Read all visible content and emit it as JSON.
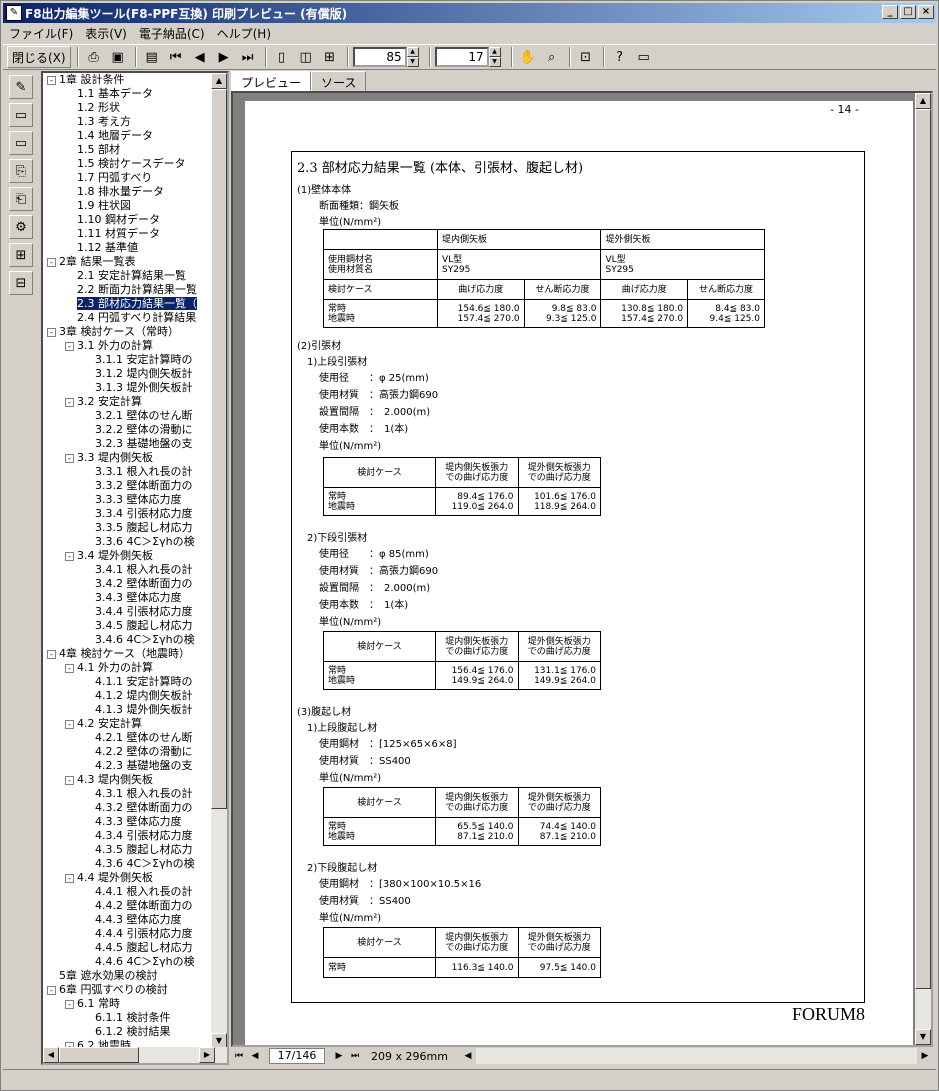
{
  "window": {
    "title": "F8出力編集ツール(F8-PPF互換) 印刷プレビュー (有償版)",
    "icon": "app-document-icon",
    "controls": [
      "_",
      "□",
      "×"
    ]
  },
  "menu": [
    "ファイル(F)",
    "表示(V)",
    "電子納品(C)",
    "ヘルプ(H)"
  ],
  "toolbar": {
    "close_label": "閉じる(X)",
    "zoom_value": "85",
    "page_value": "17"
  },
  "tree": {
    "items": [
      {
        "d": 0,
        "e": "-",
        "t": "1章 設計条件"
      },
      {
        "d": 1,
        "t": "1.1 基本データ"
      },
      {
        "d": 1,
        "t": "1.2 形状"
      },
      {
        "d": 1,
        "t": "1.3 考え方"
      },
      {
        "d": 1,
        "t": "1.4 地層データ"
      },
      {
        "d": 1,
        "t": "1.5 部材"
      },
      {
        "d": 1,
        "t": "1.5 検討ケースデータ"
      },
      {
        "d": 1,
        "t": "1.7 円弧すべり"
      },
      {
        "d": 1,
        "t": "1.8 排水量データ"
      },
      {
        "d": 1,
        "t": "1.9 柱状図"
      },
      {
        "d": 1,
        "t": "1.10 鋼材データ"
      },
      {
        "d": 1,
        "t": "1.11 材質データ"
      },
      {
        "d": 1,
        "t": "1.12 基準値"
      },
      {
        "d": 0,
        "e": "-",
        "t": "2章 結果一覧表"
      },
      {
        "d": 1,
        "t": "2.1 安定計算結果一覧"
      },
      {
        "d": 1,
        "t": "2.2 断面力計算結果一覧"
      },
      {
        "d": 1,
        "t": "2.3 部材応力結果一覧（",
        "s": true
      },
      {
        "d": 1,
        "t": "2.4 円弧すべり計算結果"
      },
      {
        "d": 0,
        "e": "-",
        "t": "3章 検討ケース（常時）"
      },
      {
        "d": 1,
        "e": "-",
        "t": "3.1 外力の計算"
      },
      {
        "d": 2,
        "t": "3.1.1 安定計算時の"
      },
      {
        "d": 2,
        "t": "3.1.2 堤内側矢板計"
      },
      {
        "d": 2,
        "t": "3.1.3 堤外側矢板計"
      },
      {
        "d": 1,
        "e": "-",
        "t": "3.2 安定計算"
      },
      {
        "d": 2,
        "t": "3.2.1 壁体のせん断"
      },
      {
        "d": 2,
        "t": "3.2.2 壁体の滑動に"
      },
      {
        "d": 2,
        "t": "3.2.3 基礎地盤の支"
      },
      {
        "d": 1,
        "e": "-",
        "t": "3.3 堤内側矢板"
      },
      {
        "d": 2,
        "t": "3.3.1 根入れ長の計"
      },
      {
        "d": 2,
        "t": "3.3.2 壁体断面力の"
      },
      {
        "d": 2,
        "t": "3.3.3 壁体応力度"
      },
      {
        "d": 2,
        "t": "3.3.4 引張材応力度"
      },
      {
        "d": 2,
        "t": "3.3.5 腹起し材応力"
      },
      {
        "d": 2,
        "t": "3.3.6 4C＞Σγhの検"
      },
      {
        "d": 1,
        "e": "-",
        "t": "3.4 堤外側矢板"
      },
      {
        "d": 2,
        "t": "3.4.1 根入れ長の計"
      },
      {
        "d": 2,
        "t": "3.4.2 壁体断面力の"
      },
      {
        "d": 2,
        "t": "3.4.3 壁体応力度"
      },
      {
        "d": 2,
        "t": "3.4.4 引張材応力度"
      },
      {
        "d": 2,
        "t": "3.4.5 腹起し材応力"
      },
      {
        "d": 2,
        "t": "3.4.6 4C＞Σγhの検"
      },
      {
        "d": 0,
        "e": "-",
        "t": "4章 検討ケース（地震時）"
      },
      {
        "d": 1,
        "e": "-",
        "t": "4.1 外力の計算"
      },
      {
        "d": 2,
        "t": "4.1.1 安定計算時の"
      },
      {
        "d": 2,
        "t": "4.1.2 堤内側矢板計"
      },
      {
        "d": 2,
        "t": "4.1.3 堤外側矢板計"
      },
      {
        "d": 1,
        "e": "-",
        "t": "4.2 安定計算"
      },
      {
        "d": 2,
        "t": "4.2.1 壁体のせん断"
      },
      {
        "d": 2,
        "t": "4.2.2 壁体の滑動に"
      },
      {
        "d": 2,
        "t": "4.2.3 基礎地盤の支"
      },
      {
        "d": 1,
        "e": "-",
        "t": "4.3 堤内側矢板"
      },
      {
        "d": 2,
        "t": "4.3.1 根入れ長の計"
      },
      {
        "d": 2,
        "t": "4.3.2 壁体断面力の"
      },
      {
        "d": 2,
        "t": "4.3.3 壁体応力度"
      },
      {
        "d": 2,
        "t": "4.3.4 引張材応力度"
      },
      {
        "d": 2,
        "t": "4.3.5 腹起し材応力"
      },
      {
        "d": 2,
        "t": "4.3.6 4C＞Σγhの検"
      },
      {
        "d": 1,
        "e": "-",
        "t": "4.4 堤外側矢板"
      },
      {
        "d": 2,
        "t": "4.4.1 根入れ長の計"
      },
      {
        "d": 2,
        "t": "4.4.2 壁体断面力の"
      },
      {
        "d": 2,
        "t": "4.4.3 壁体応力度"
      },
      {
        "d": 2,
        "t": "4.4.4 引張材応力度"
      },
      {
        "d": 2,
        "t": "4.4.5 腹起し材応力"
      },
      {
        "d": 2,
        "t": "4.4.6 4C＞Σγhの検"
      },
      {
        "d": 0,
        "t": "5章 遮水効果の検討"
      },
      {
        "d": 0,
        "e": "-",
        "t": "6章 円弧すべりの検討"
      },
      {
        "d": 1,
        "e": "-",
        "t": "6.1 常時"
      },
      {
        "d": 2,
        "t": "6.1.1 検討条件"
      },
      {
        "d": 2,
        "t": "6.1.2 検討結果"
      },
      {
        "d": 1,
        "e": "-",
        "t": "6.2 地震時"
      }
    ]
  },
  "tabs": [
    "プレビュー",
    "ソース"
  ],
  "nav": {
    "page": "17/146",
    "size": "209 x 296mm"
  },
  "doc": {
    "page_number": "- 14 -",
    "section_title": "2.3 部材応力結果一覧 (本体、引張材、腹起し材)",
    "s1": "(1)壁体本体",
    "s1_type": "断面種類：鋼矢板",
    "s1_unit": "単位(N/mm²)",
    "t1": {
      "h_in": "堤内側矢板",
      "h_out": "堤外側矢板",
      "mat_label": "使用鋼材名\n使用材質名",
      "mat_in": "VL型\nSY295",
      "mat_out": "VL型\nSY295",
      "case_label": "検討ケース",
      "c1": "曲げ応力度",
      "c2": "せん断応力度",
      "c3": "曲げ応力度",
      "c4": "せん断応力度",
      "cases": "常時\n地震時",
      "v1": "154.6≦ 180.0\n157.4≦ 270.0",
      "v2": "9.8≦  83.0\n9.3≦ 125.0",
      "v3": "130.8≦ 180.0\n157.4≦ 270.0",
      "v4": "8.4≦  83.0\n9.4≦ 125.0"
    },
    "s2": "(2)引張材",
    "s2a": "1)上段引張材",
    "s2a_l1": "使用径　　：φ 25(mm)",
    "s2a_l2": "使用材質　：高張力鋼690",
    "s2a_l3": "設置間隔　：　2.000(m)",
    "s2a_l4": "使用本数　：　1(本)",
    "s2a_unit": "単位(N/mm²)",
    "t2": {
      "case": "検討ケース",
      "h1": "堤内側矢板張力\nでの曲げ応力度",
      "h2": "堤外側矢板張力\nでの曲げ応力度",
      "cases": "常時\n地震時",
      "v1": "89.4≦ 176.0\n119.0≦ 264.0",
      "v2": "101.6≦ 176.0\n118.9≦ 264.0"
    },
    "s2b": "2)下段引張材",
    "s2b_l1": "使用径　　：φ 85(mm)",
    "s2b_l2": "使用材質　：高張力鋼690",
    "s2b_l3": "設置間隔　：　2.000(m)",
    "s2b_l4": "使用本数　：　1(本)",
    "s2b_unit": "単位(N/mm²)",
    "t3": {
      "case": "検討ケース",
      "h1": "堤内側矢板張力\nでの曲げ応力度",
      "h2": "堤外側矢板張力\nでの曲げ応力度",
      "cases": "常時\n地震時",
      "v1": "156.4≦ 176.0\n149.9≦ 264.0",
      "v2": "131.1≦ 176.0\n149.9≦ 264.0"
    },
    "s3": "(3)腹起し材",
    "s3a": "1)上段腹起し材",
    "s3a_l1": "使用鋼材　：[125×65×6×8]",
    "s3a_l2": "使用材質　：SS400",
    "s3a_unit": "単位(N/mm²)",
    "t4": {
      "case": "検討ケース",
      "h1": "堤内側矢板張力\nでの曲げ応力度",
      "h2": "堤外側矢板張力\nでの曲げ応力度",
      "cases": "常時\n地震時",
      "v1": "65.5≦ 140.0\n87.1≦ 210.0",
      "v2": "74.4≦ 140.0\n87.1≦ 210.0"
    },
    "s3b": "2)下段腹起し材",
    "s3b_l1": "使用鋼材　：[380×100×10.5×16",
    "s3b_l2": "使用材質　：SS400",
    "s3b_unit": "単位(N/mm²)",
    "t5": {
      "case": "検討ケース",
      "h1": "堤内側矢板張力\nでの曲げ応力度",
      "h2": "堤外側矢板張力\nでの曲げ応力度",
      "cases": "常時",
      "v1": "116.3≦ 140.0",
      "v2": "97.5≦ 140.0"
    },
    "footer": "FORUM8"
  }
}
